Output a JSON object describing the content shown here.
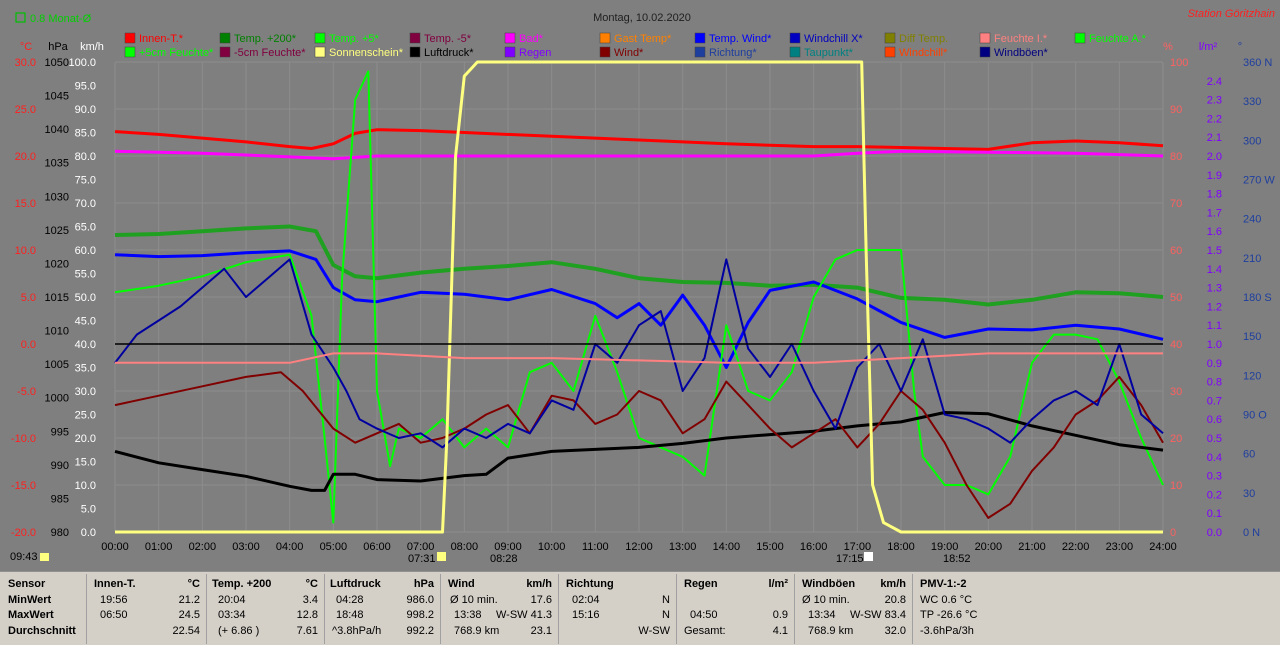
{
  "title": "Montag, 10.02.2020",
  "station": "Station Göritzhain",
  "top_left_indicator": "0.8 Monat-Ø",
  "colors": {
    "bg": "#7f7f7f",
    "grid": "#8c8c8c",
    "temp_axis": "#ff2020",
    "hpa_axis": "#000000",
    "kmh_axis": "#ffffff",
    "pct_axis": "#ff6060",
    "rain_axis": "#8000ff",
    "dir_axis": "#1f3f9f"
  },
  "axes": {
    "headers": {
      "temp": "°C",
      "hpa": "hPa",
      "kmh": "km/h",
      "pct": "%",
      "rain": "l/m²",
      "dir": "°"
    },
    "temp_ticks": [
      "30.0",
      "25.0",
      "20.0",
      "15.0",
      "10.0",
      "5.0",
      "0.0",
      "-5.0",
      "-10.0",
      "-15.0",
      "-20.0"
    ],
    "hpa_ticks": [
      "1050",
      "1045",
      "1040",
      "1035",
      "1030",
      "1025",
      "1020",
      "1015",
      "1010",
      "1005",
      "1000",
      "995",
      "990",
      "985",
      "980"
    ],
    "kmh_ticks": [
      "100.0",
      "95.0",
      "90.0",
      "85.0",
      "80.0",
      "75.0",
      "70.0",
      "65.0",
      "60.0",
      "55.0",
      "50.0",
      "45.0",
      "40.0",
      "35.0",
      "30.0",
      "25.0",
      "20.0",
      "15.0",
      "10.0",
      "5.0",
      "0.0"
    ],
    "pct_ticks": [
      "100",
      "90",
      "80",
      "70",
      "60",
      "50",
      "40",
      "30",
      "20",
      "10",
      "0"
    ],
    "rain_ticks": [
      "2.4",
      "2.3",
      "2.2",
      "2.1",
      "2.0",
      "1.9",
      "1.8",
      "1.7",
      "1.6",
      "1.5",
      "1.4",
      "1.3",
      "1.2",
      "1.1",
      "1.0",
      "0.9",
      "0.8",
      "0.7",
      "0.6",
      "0.5",
      "0.4",
      "0.3",
      "0.2",
      "0.1",
      "0.0"
    ],
    "dir_ticks": [
      "360 N",
      "330",
      "300",
      "270 W",
      "240",
      "210",
      "180 S",
      "150",
      "120",
      "90 O",
      "60",
      "30",
      "0   N"
    ],
    "x_ticks": [
      "00:00",
      "01:00",
      "02:00",
      "03:00",
      "04:00",
      "05:00",
      "06:00",
      "07:00",
      "08:00",
      "09:00",
      "10:00",
      "11:00",
      "12:00",
      "13:00",
      "14:00",
      "15:00",
      "16:00",
      "17:00",
      "18:00",
      "19:00",
      "20:00",
      "21:00",
      "22:00",
      "23:00",
      "24:00"
    ]
  },
  "sun_markers": {
    "moonrise": "09:43",
    "sunrise": "07:31",
    "sun_high": "08:28",
    "sunset": "17:15",
    "moonset": "18:52"
  },
  "legend_row1": [
    {
      "label": "Innen-T.*",
      "color": "#ff0000"
    },
    {
      "label": "Temp. +200*",
      "color": "#008000"
    },
    {
      "label": "Temp. +5*",
      "color": "#00ff00"
    },
    {
      "label": "Temp. -5*",
      "color": "#800040"
    },
    {
      "label": "Bad*",
      "color": "#ff00ff"
    },
    {
      "label": "Gast Temp*",
      "color": "#ff8000"
    },
    {
      "label": "Temp. Wind*",
      "color": "#0000ff"
    },
    {
      "label": "Windchill X*",
      "color": "#0000c0"
    },
    {
      "label": "Diff Temp.",
      "color": "#808000"
    },
    {
      "label": "Feuchte I.*",
      "color": "#ff8080"
    },
    {
      "label": "Feuchte A.*",
      "color": "#00ff00"
    }
  ],
  "legend_row2": [
    {
      "label": "+5cm Feuchte*",
      "color": "#00ff00"
    },
    {
      "label": "-5cm Feuchte*",
      "color": "#800040"
    },
    {
      "label": "Sonnenschein*",
      "color": "#ffff80"
    },
    {
      "label": "Luftdruck*",
      "color": "#000000"
    },
    {
      "label": "Regen",
      "color": "#8000ff"
    },
    {
      "label": "Wind*",
      "color": "#800000"
    },
    {
      "label": "Richtung*",
      "color": "#1f3f9f"
    },
    {
      "label": "Taupunkt*",
      "color": "#008080"
    },
    {
      "label": "Windchill*",
      "color": "#ff4000"
    },
    {
      "label": "Windböen*",
      "color": "#000080"
    }
  ],
  "chart_data": {
    "type": "line",
    "title": "Montag, 10.02.2020",
    "x_unit": "hour of day",
    "xlim": [
      0,
      24
    ],
    "primary_ylim_temp_c": [
      -20,
      30
    ],
    "series": [
      {
        "name": "Innen-T.*",
        "unit": "°C",
        "color": "#ff0000",
        "width": 3,
        "x": [
          0,
          1,
          2,
          3,
          4,
          4.5,
          5,
          5.5,
          6,
          7,
          8,
          10,
          12,
          14,
          16,
          17,
          18,
          19,
          20,
          21,
          22,
          23,
          24
        ],
        "y": [
          22.6,
          22.3,
          21.9,
          21.5,
          21.0,
          20.8,
          21.3,
          22.4,
          22.8,
          22.7,
          22.5,
          22.1,
          21.7,
          21.3,
          21.0,
          21.0,
          20.9,
          20.8,
          20.7,
          21.4,
          21.6,
          21.4,
          21.1
        ]
      },
      {
        "name": "Bad*",
        "unit": "°C",
        "color": "#ff00ff",
        "width": 3,
        "x": [
          0,
          2,
          4,
          5,
          6,
          8,
          10,
          12,
          14,
          16,
          17,
          18,
          20,
          22,
          24
        ],
        "y": [
          20.5,
          20.3,
          19.9,
          19.7,
          20.0,
          20.0,
          20.0,
          20.0,
          20.0,
          20.0,
          20.3,
          20.5,
          20.4,
          20.3,
          20.0
        ]
      },
      {
        "name": "Temp. +200*",
        "unit": "°C",
        "color": "#20a020",
        "width": 4,
        "x": [
          0,
          1,
          2,
          3,
          4,
          4.6,
          5,
          5.5,
          6,
          7,
          8,
          9,
          10,
          11,
          12,
          13,
          14,
          15,
          16,
          17,
          18,
          19,
          20,
          21,
          22,
          23,
          24
        ],
        "y": [
          11.6,
          11.7,
          12.0,
          12.3,
          12.5,
          12.0,
          8.4,
          7.2,
          7.0,
          7.6,
          8.0,
          8.3,
          8.7,
          8.0,
          7.0,
          6.6,
          6.5,
          6.2,
          6.3,
          6.0,
          4.9,
          4.7,
          4.2,
          4.7,
          5.5,
          5.4,
          5.0
        ]
      },
      {
        "name": "Temp. Wind*",
        "unit": "°C",
        "color": "#0000ff",
        "width": 3,
        "x": [
          0,
          1,
          2,
          3,
          4,
          4.6,
          5,
          5.5,
          6,
          6.5,
          7,
          8,
          9,
          10,
          11,
          11.5,
          12,
          12.5,
          13,
          13.5,
          14,
          14.5,
          15,
          16,
          17,
          18,
          19,
          20,
          21,
          22,
          23,
          24
        ],
        "y": [
          9.5,
          9.3,
          9.4,
          9.7,
          9.9,
          9.0,
          6.0,
          4.7,
          4.5,
          5.0,
          5.5,
          5.3,
          4.7,
          5.8,
          4.3,
          2.8,
          4.3,
          2.0,
          5.2,
          2.0,
          -2.5,
          2.3,
          5.7,
          6.6,
          4.8,
          2.3,
          0.7,
          1.6,
          1.5,
          2.0,
          1.6,
          0.5
        ]
      },
      {
        "name": "Temp. +5*",
        "unit": "°C",
        "color": "#00ff00",
        "width": 2,
        "x": [
          0,
          1,
          2,
          3,
          4,
          4.5,
          4.8,
          5,
          5.2,
          5.5,
          5.8,
          6,
          6.3,
          6.5,
          7,
          7.5,
          8,
          8.5,
          9,
          9.5,
          10,
          10.5,
          11,
          11.5,
          12,
          12.5,
          13,
          13.5,
          14,
          14.5,
          15,
          15.5,
          16,
          16.5,
          17,
          17.5,
          18,
          18.3,
          18.5,
          19,
          19.5,
          20,
          20.5,
          21,
          21.5,
          22,
          22.5,
          23,
          23.5,
          24
        ],
        "y": [
          5.5,
          6.2,
          7.2,
          8.7,
          9.5,
          3.0,
          -10.0,
          -19.0,
          7.0,
          26.0,
          29.0,
          -5.0,
          -13.0,
          -9.0,
          -10.0,
          -8.0,
          -11.0,
          -9.0,
          -11.0,
          -3.0,
          -2.0,
          -5.0,
          3.0,
          -3.0,
          -10.0,
          -11.0,
          -12.0,
          -14.0,
          2.0,
          -5.0,
          -6.0,
          -3.0,
          5.0,
          9.0,
          10.0,
          10.0,
          10.0,
          -5.0,
          -12.0,
          -15.0,
          -15.0,
          -16.0,
          -12.0,
          -2.0,
          1.0,
          1.0,
          0.5,
          -4.0,
          -10.0,
          -15.0
        ]
      },
      {
        "name": "Luftdruck*",
        "unit": "hPa",
        "color": "#000000",
        "width": 3,
        "x": [
          0,
          1,
          2,
          3,
          4,
          4.5,
          4.8,
          5,
          5.5,
          6,
          7,
          8,
          8.5,
          9,
          10,
          11,
          12,
          13,
          14,
          15,
          16,
          17,
          18,
          19,
          20,
          21,
          22,
          23,
          24
        ],
        "y": [
          992.0,
          990.3,
          989.3,
          988.3,
          986.8,
          986.2,
          986.2,
          988.6,
          988.6,
          987.8,
          987.6,
          988.4,
          988.6,
          991.0,
          992.0,
          992.3,
          992.6,
          993.2,
          994.0,
          994.5,
          995.0,
          995.8,
          996.4,
          997.8,
          997.6,
          995.8,
          994.4,
          993.0,
          992.2
        ]
      },
      {
        "name": "Wind*",
        "unit": "km/h",
        "color": "#800000",
        "width": 2,
        "x": [
          0,
          1,
          2,
          3,
          3.8,
          4.3,
          5,
          5.5,
          6,
          6.5,
          7,
          7.5,
          8,
          8.5,
          9,
          9.5,
          10,
          10.5,
          11,
          11.5,
          12,
          12.5,
          13,
          13.5,
          14,
          14.5,
          15,
          15.5,
          16,
          16.5,
          17,
          17.5,
          18,
          18.5,
          19,
          19.5,
          20,
          20.5,
          21,
          21.5,
          22,
          22.5,
          23,
          23.5,
          24
        ],
        "y": [
          27,
          29,
          31,
          33,
          34,
          30,
          22,
          19,
          21,
          23,
          19,
          20,
          22,
          25,
          27,
          21,
          29,
          28,
          23,
          25,
          30,
          28,
          21,
          24,
          32,
          27,
          22,
          18,
          21,
          24,
          18,
          23,
          30,
          26,
          19,
          10,
          3,
          6,
          13,
          18,
          25,
          28,
          33,
          27,
          19
        ]
      },
      {
        "name": "Windböen*",
        "unit": "km/h",
        "color": "#0000a0",
        "width": 2,
        "x": [
          0,
          0.5,
          1,
          1.5,
          2,
          2.5,
          3,
          3.5,
          4,
          4.5,
          5,
          5.3,
          5.6,
          6,
          6.5,
          7,
          7.5,
          8,
          8.5,
          9,
          9.5,
          10,
          10.5,
          11,
          11.5,
          12,
          12.5,
          13,
          13.5,
          14,
          14.5,
          15,
          15.5,
          16,
          16.5,
          17,
          17.5,
          18,
          18.5,
          19,
          19.5,
          20,
          20.5,
          21,
          21.5,
          22,
          22.5,
          23,
          23.5,
          24
        ],
        "y": [
          36,
          42,
          45,
          48,
          52,
          56,
          50,
          54,
          58,
          42,
          35,
          30,
          24,
          22,
          20,
          21,
          18,
          22,
          20,
          23,
          21,
          28,
          26,
          40,
          36,
          44,
          47,
          30,
          37,
          58,
          39,
          33,
          40,
          30,
          22,
          35,
          40,
          30,
          41,
          25,
          24,
          22,
          19,
          24,
          28,
          30,
          27,
          40,
          25,
          21
        ]
      },
      {
        "name": "Sonnenschein*",
        "unit": "%",
        "color": "#ffff80",
        "width": 3,
        "x": [
          0,
          7.5,
          7.6,
          7.8,
          8.0,
          8.3,
          8.6,
          9,
          10,
          12,
          14,
          16,
          17.1,
          17.2,
          17.35,
          17.6,
          18,
          24
        ],
        "y": [
          0,
          0,
          20,
          80,
          97,
          100,
          100,
          100,
          100,
          100,
          100,
          100,
          100,
          60,
          10,
          2,
          0,
          0
        ]
      },
      {
        "name": "Feuchte I.*",
        "unit": "%",
        "color": "#ff8080",
        "width": 2,
        "x": [
          0,
          2,
          4,
          5,
          6,
          8,
          10,
          12,
          14,
          16,
          18,
          20,
          22,
          24
        ],
        "y": [
          36,
          36,
          36,
          38,
          38,
          37,
          37,
          36.5,
          36,
          36,
          37,
          38,
          38,
          38
        ]
      },
      {
        "name": "Luftdruck Ref.",
        "unit": "hPa",
        "color": "#000000",
        "width": 1.5,
        "x": [
          0,
          24
        ],
        "y": [
          1008,
          1008
        ]
      }
    ]
  },
  "footer": {
    "sensor": {
      "h": "Sensor",
      "r1": "MinWert",
      "r2": "MaxWert",
      "r3": "Durchschnitt"
    },
    "innen": {
      "h": "Innen-T.",
      "u": "°C",
      "r1t": "19:56",
      "r1v": "21.2",
      "r2t": "06:50",
      "r2v": "24.5",
      "r3v": "22.54"
    },
    "temp200": {
      "h": "Temp. +200",
      "u": "°C",
      "r1t": "20:04",
      "r1v": "3.4",
      "r2t": "03:34",
      "r2v": "12.8",
      "r3t": "(+ 6.86 )",
      "r3v": "7.61"
    },
    "druck": {
      "h": "Luftdruck",
      "u": "hPa",
      "r1t": "04:28",
      "r1v": "986.0",
      "r2t": "18:48",
      "r2v": "998.2",
      "r3t": "^3.8hPa/h",
      "r3v": "992.2"
    },
    "wind": {
      "h": "Wind",
      "u": "km/h",
      "r1t": "Ø 10 min.",
      "r1v": "17.6",
      "r2t": "13:38",
      "r2m": "W-SW",
      "r2v": "41.3",
      "r3t": "768.9 km",
      "r3v": "23.1"
    },
    "richtung": {
      "h": "Richtung",
      "r1t": "02:04",
      "r1v": "N",
      "r2t": "15:16",
      "r2v": "N",
      "r3v": "W-SW"
    },
    "regen": {
      "h": "Regen",
      "u": "l/m²",
      "r2t": "04:50",
      "r2v": "0.9",
      "r3t": "Gesamt:",
      "r3v": "4.1"
    },
    "boeen": {
      "h": "Windböen",
      "u": "km/h",
      "r1t": "Ø 10 min.",
      "r1v": "20.8",
      "r2t": "13:34",
      "r2m": "W-SW",
      "r2v": "83.4",
      "r3t": "768.9 km",
      "r3v": "32.0"
    },
    "pmv": {
      "h": "PMV-1:-2",
      "r1": "WC 0.6 °C",
      "r2": "TP -26.6 °C",
      "r3": "-3.6hPa/3h"
    }
  }
}
